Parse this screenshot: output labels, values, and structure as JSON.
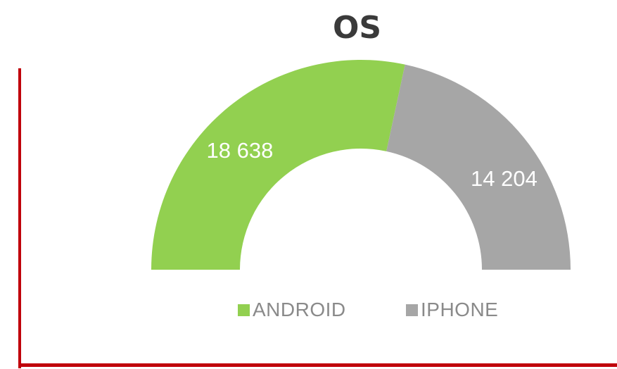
{
  "chart_data": {
    "type": "pie",
    "subtype": "semi-donut",
    "title": "OS",
    "categories": [
      "ANDROID",
      "IPHONE"
    ],
    "values": [
      18638,
      14204
    ],
    "value_labels": [
      "18 638",
      "14 204"
    ],
    "colors": [
      "#92d050",
      "#a6a6a6"
    ],
    "legend_position": "bottom"
  }
}
